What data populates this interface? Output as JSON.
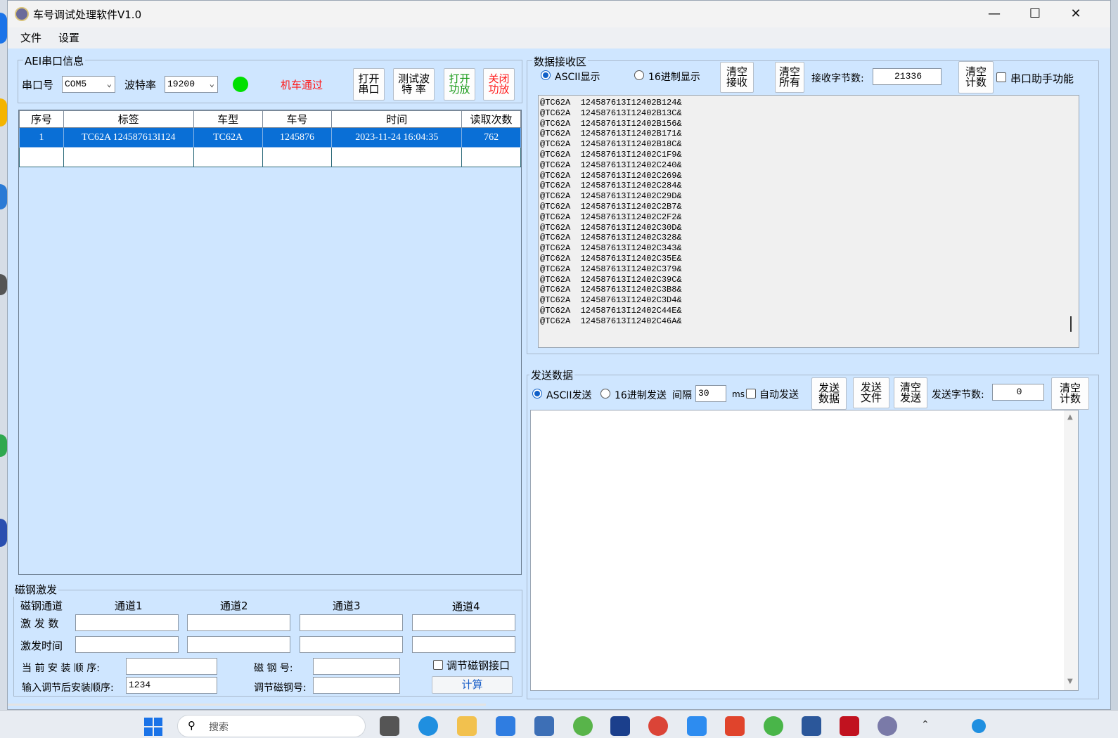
{
  "window": {
    "title": "车号调试处理软件V1.0"
  },
  "menu": {
    "file": "文件",
    "settings": "设置"
  },
  "aei": {
    "group_label": "AEI串口信息",
    "port_label": "串口号",
    "port_value": "COM5",
    "baud_label": "波特率",
    "baud_value": "19200",
    "status_text": "机车通过",
    "status_color": "#00e000",
    "btn_open_port": "打开串口",
    "btn_test_baud": "测试波特 率",
    "btn_open_amp": "打开功放",
    "btn_close_amp": "关闭功放"
  },
  "table": {
    "columns": [
      "序号",
      "标签",
      "车型",
      "车号",
      "时间",
      "读取次数"
    ],
    "rows": [
      [
        "1",
        "TC62A  124587613I124",
        "TC62A",
        "1245876",
        "2023-11-24 16:04:35",
        "762"
      ]
    ]
  },
  "magnet": {
    "group_label": "磁钢激发",
    "channel_header": "磁钢通道",
    "channels": [
      "通道1",
      "通道2",
      "通道3",
      "通道4"
    ],
    "row_count_label": "激 发 数",
    "row_time_label": "激发时间",
    "current_order_label": "当 前 安 装 顺 序:",
    "current_order_value": "",
    "magnet_no_label": "磁  钢  号:",
    "magnet_no_value": "",
    "adjust_check_label": "调节磁钢接口",
    "input_order_label": "输入调节后安装顺序:",
    "input_order_value": "1234",
    "adjust_no_label": "调节磁钢号:",
    "adjust_no_value": "",
    "calc_button": "计算"
  },
  "recv": {
    "group_label": "数据接收区",
    "ascii_label": "ASCII显示",
    "hex_label": "16进制显示",
    "btn_clear_recv": "清空接收",
    "btn_clear_all": "清空所有",
    "bytes_label": "接收字节数:",
    "bytes_value": "21336",
    "btn_clear_count": "清空计数",
    "helper_label": "串口助手功能",
    "lines": [
      "@TC62A  124587613I12402B124&",
      "@TC62A  124587613I12402B13C&",
      "@TC62A  124587613I12402B156&",
      "@TC62A  124587613I12402B171&",
      "@TC62A  124587613I12402B18C&",
      "@TC62A  124587613I12402C1F9&",
      "@TC62A  124587613I12402C240&",
      "@TC62A  124587613I12402C269&",
      "@TC62A  124587613I12402C284&",
      "@TC62A  124587613I12402C29D&",
      "@TC62A  124587613I12402C2B7&",
      "@TC62A  124587613I12402C2F2&",
      "@TC62A  124587613I12402C30D&",
      "@TC62A  124587613I12402C328&",
      "@TC62A  124587613I12402C343&",
      "@TC62A  124587613I12402C35E&",
      "@TC62A  124587613I12402C379&",
      "@TC62A  124587613I12402C39C&",
      "@TC62A  124587613I12402C3B8&",
      "@TC62A  124587613I12402C3D4&",
      "@TC62A  124587613I12402C44E&",
      "@TC62A  124587613I12402C46A&"
    ]
  },
  "send": {
    "group_label": "发送数据",
    "ascii_label": "ASCII发送",
    "hex_label": "16进制发送",
    "interval_label": "间隔",
    "interval_value": "30",
    "ms_label": "ms",
    "auto_label": "自动发送",
    "btn_send_data": "发送数据",
    "btn_send_file": "发送文件",
    "btn_clear_send": "清空发送",
    "bytes_label": "发送字节数:",
    "bytes_value": "0",
    "btn_clear_count": "清空计数"
  },
  "taskbar": {
    "search_placeholder": "搜索"
  }
}
